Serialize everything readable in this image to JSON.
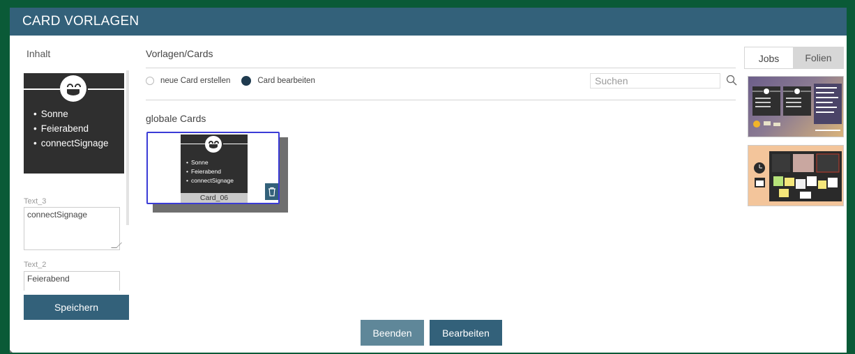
{
  "window": {
    "title": "CARD VORLAGEN"
  },
  "left_panel": {
    "label": "Inhalt",
    "preview_items": [
      "Sonne",
      "Feierabend",
      "connectSignage"
    ],
    "fields": [
      {
        "label": "Text_3",
        "value": "connectSignage"
      },
      {
        "label": "Text_2",
        "value": "Feierabend"
      }
    ],
    "save_label": "Speichern"
  },
  "center_panel": {
    "label": "Vorlagen/Cards",
    "mode_options": [
      {
        "label": "neue Card erstellen",
        "checked": false
      },
      {
        "label": "Card bearbeiten",
        "checked": true
      }
    ],
    "search": {
      "placeholder": "Suchen",
      "value": ""
    },
    "section_label": "globale Cards",
    "card": {
      "items": [
        "Sonne",
        "Feierabend",
        "connectSignage"
      ],
      "caption": "Card_06"
    }
  },
  "footer": {
    "cancel_label": "Beenden",
    "edit_label": "Bearbeiten"
  },
  "right_panel": {
    "tabs": [
      {
        "label": "Jobs",
        "active": true
      },
      {
        "label": "Folien",
        "active": false
      }
    ]
  },
  "colors": {
    "accent": "#33617a",
    "selection_border": "#3a3bd6",
    "background": "#0a5a37"
  }
}
